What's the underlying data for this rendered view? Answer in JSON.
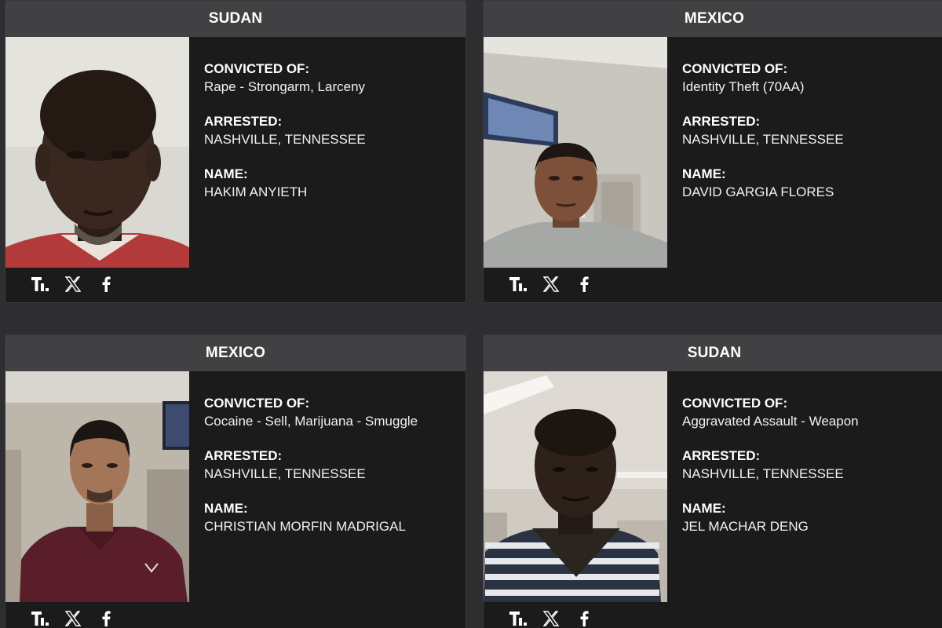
{
  "cards": [
    {
      "country": "SUDAN",
      "convicted_label": "CONVICTED OF:",
      "convicted_value": "Rape - Strongarm, Larceny",
      "arrested_label": "ARRESTED:",
      "arrested_value": "NASHVILLE, TENNESSEE",
      "name_label": "NAME:",
      "name_value": "HAKIM ANYIETH"
    },
    {
      "country": "MEXICO",
      "convicted_label": "CONVICTED OF:",
      "convicted_value": "Identity Theft (70AA)",
      "arrested_label": "ARRESTED:",
      "arrested_value": "NASHVILLE, TENNESSEE",
      "name_label": "NAME:",
      "name_value": "DAVID GARGIA FLORES"
    },
    {
      "country": "MEXICO",
      "convicted_label": "CONVICTED OF:",
      "convicted_value": "Cocaine - Sell, Marijuana - Smuggle",
      "arrested_label": "ARRESTED:",
      "arrested_value": "NASHVILLE, TENNESSEE",
      "name_label": "NAME:",
      "name_value": "CHRISTIAN MORFIN MADRIGAL"
    },
    {
      "country": "SUDAN",
      "convicted_label": "CONVICTED OF:",
      "convicted_value": "Aggravated Assault - Weapon",
      "arrested_label": "ARRESTED:",
      "arrested_value": "NASHVILLE, TENNESSEE",
      "name_label": "NAME:",
      "name_value": "JEL MACHAR DENG"
    }
  ],
  "share": {
    "icons": [
      "truth-social-icon",
      "x-icon",
      "facebook-icon"
    ]
  },
  "colors": {
    "page_bg": "#2e2e30",
    "card_bg": "#1b1b1c",
    "header_bg": "#414143",
    "text": "#ffffff"
  }
}
